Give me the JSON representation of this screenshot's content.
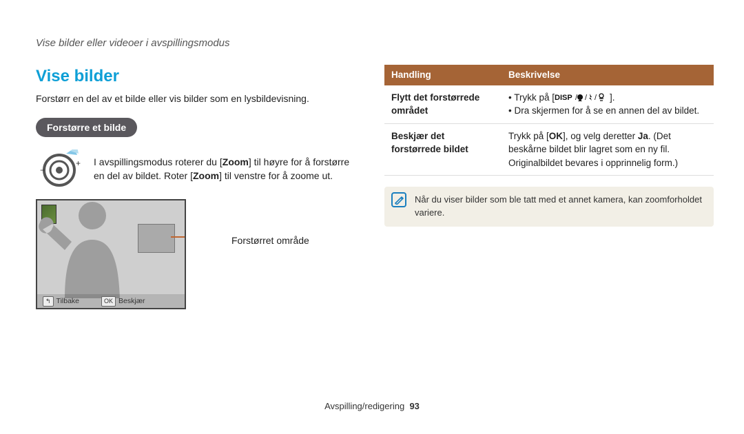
{
  "breadcrumb": "Vise bilder eller videoer i avspillingsmodus",
  "section_title": "Vise bilder",
  "intro": "Forstørr en del av et bilde eller vis bilder som en lysbildevisning.",
  "subsection_pill": "Forstørre et bilde",
  "zoom_instruction": {
    "pre": "I avspillingsmodus roterer du [",
    "zoom1": "Zoom",
    "mid1": "] til høyre for å forstørre en del av bildet. Roter [",
    "zoom2": "Zoom",
    "mid2": "] til venstre for å zoome ut."
  },
  "preview": {
    "back_key": "↰",
    "back_label": "Tilbake",
    "ok_key": "OK",
    "ok_label": "Beskjær",
    "callout": "Forstørret område"
  },
  "table": {
    "head_action": "Handling",
    "head_desc": "Beskrivelse",
    "row1": {
      "action": "Flytt det forstørrede området",
      "desc_line1_pre": "Trykk på [",
      "desc_line1_post": "].",
      "desc_line2": "Dra skjermen for å se en annen del av bildet."
    },
    "row2": {
      "action": "Beskjær det forstørrede bildet",
      "desc_pre": "Trykk på [",
      "desc_ok": "OK",
      "desc_mid": "], og velg deretter ",
      "desc_ja": "Ja",
      "desc_post": ". (Det beskårne bildet blir lagret som en ny fil. Originalbildet bevares i opprinnelig form.)"
    }
  },
  "note_text": "Når du viser bilder som ble tatt med et annet kamera, kan zoomforholdet variere.",
  "footer_section": "Avspilling/redigering",
  "footer_page": "93"
}
